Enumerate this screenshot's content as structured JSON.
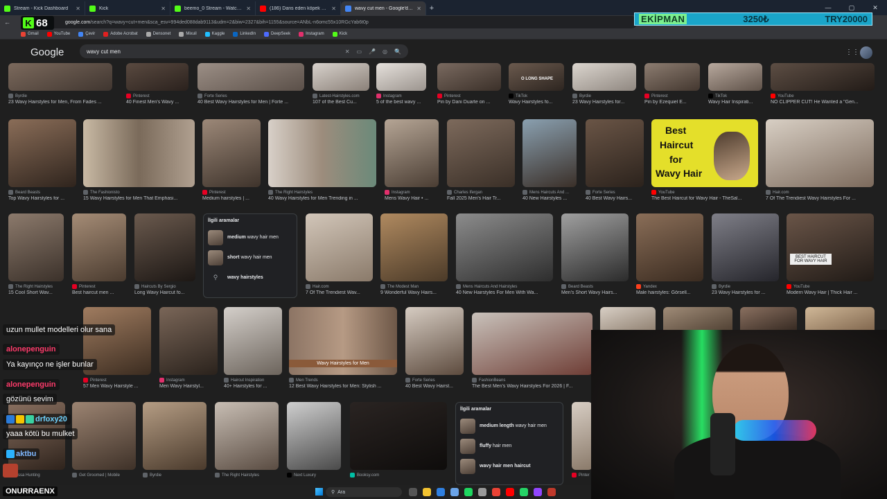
{
  "browser": {
    "tabs": [
      {
        "title": "Stream - Kick Dashboard",
        "color": "#53fc18",
        "active": false
      },
      {
        "title": "Kick",
        "color": "#53fc18",
        "active": false
      },
      {
        "title": "beemo_0 Stream - Watch Live o...",
        "color": "#53fc18",
        "active": false
      },
      {
        "title": "(186) Dans eden köpek vs kız",
        "color": "#ff0000",
        "active": false
      },
      {
        "title": "wavy cut men - Google'da Ara",
        "color": "#4285f4",
        "active": true
      }
    ],
    "new_tab_label": "+",
    "url_host": "google.com",
    "url_rest": "/search?q=wavy+cut+men&sca_esv=994ded088dab9113&udm=2&biw=2327&bih=1155&source=ANbL-n6omc55x10RGcYab6t0p",
    "window_controls": [
      "—",
      "▢",
      "✕"
    ]
  },
  "kick_overlay": {
    "count": "68",
    "logo_letter": "K"
  },
  "goal_bar": {
    "label": "EKİPMAN",
    "current": "3250₺",
    "target": "TRY20000"
  },
  "bookmarks": [
    {
      "label": "Gmail",
      "color": "#ea4335"
    },
    {
      "label": "YouTube",
      "color": "#ff0000"
    },
    {
      "label": "Çevir",
      "color": "#4285f4"
    },
    {
      "label": "Adobe Acrobat",
      "color": "#e02020"
    },
    {
      "label": "Densonet",
      "color": "#aaaaaa"
    },
    {
      "label": "Mixuil",
      "color": "#aaaaaa"
    },
    {
      "label": "Kaggle",
      "color": "#20beff"
    },
    {
      "label": "LinkedIn",
      "color": "#0a66c2"
    },
    {
      "label": "DeepSeek",
      "color": "#4d6bfe"
    },
    {
      "label": "Instagram",
      "color": "#e1306c"
    },
    {
      "label": "Kick",
      "color": "#53fc18"
    }
  ],
  "google": {
    "logo": "Google",
    "query": "wavy cut men",
    "search_icons": [
      "✕",
      "▭",
      "🎤",
      "◎",
      "🔍"
    ],
    "apps_icon": "⋮⋮⋮"
  },
  "row1": [
    {
      "source": "Byrdie",
      "caption": "23 Wavy Hairstyles for Men, From Fades ..."
    },
    {
      "source": "Pinterest",
      "caption": "40 Finest Men's Wavy ..."
    },
    {
      "source": "Forte Series",
      "caption": "40 Best Wavy Hairstyles for Men | Forte ..."
    },
    {
      "source": "Latest-Hairstyles.com",
      "caption": "107 of the Best Cu..."
    },
    {
      "source": "Instagram",
      "caption": "5 of the best wavy ..."
    },
    {
      "source": "Pinterest",
      "caption": "Pin by Dani Duarte on ..."
    },
    {
      "source": "TikTok",
      "caption": "Wavy Hairstyles fo..."
    },
    {
      "source": "Byrdie",
      "caption": "23 Wavy Hairstyles for..."
    },
    {
      "source": "Pinterest",
      "caption": "Pin by Ezequiel E..."
    },
    {
      "source": "TikTok",
      "caption": "Wavy Hair Inspirati..."
    },
    {
      "source": "YouTube",
      "caption": "NO CLIPPER CUT! He Wanted a \"Gen..."
    }
  ],
  "row2": [
    {
      "source": "Beard Beasts",
      "caption": "Top Wavy Hairstyles for ..."
    },
    {
      "source": "The Fashionisto",
      "caption": "15 Wavy Hairstyles for Men That Emphasi..."
    },
    {
      "source": "Pinterest",
      "caption": "Medium hairstyles | ..."
    },
    {
      "source": "The Right Hairstyles",
      "caption": "40 Wavy Hairstyles for Men Trending in ..."
    },
    {
      "source": "Instagram",
      "caption": "Mens Wavy Hair • ..."
    },
    {
      "source": "Charles Ifergan",
      "caption": "Fall 2025 Men's Hair Tr..."
    },
    {
      "source": "Mens Haircuts And ...",
      "caption": "40 New Hairstyles ..."
    },
    {
      "source": "Forte Series",
      "caption": "40 Best Wavy Hairs..."
    },
    {
      "source": "YouTube",
      "caption": "The Best Haircut for Wavy Hair - TheSal..."
    },
    {
      "source": "Hair.com",
      "caption": "7 Of The Trendiest Wavy Hairstyles For ..."
    }
  ],
  "yellow_card": {
    "l1": "Best",
    "l2": "Haircut",
    "l3": "for",
    "l4": "Wavy Hair"
  },
  "row3": [
    {
      "source": "The Right Hairstyles",
      "caption": "15 Cool Short Wav..."
    },
    {
      "source": "Pinterest",
      "caption": "Best haircut men ..."
    },
    {
      "source": "Haircuts By Sergio",
      "caption": "Long Wavy Haircut fo..."
    },
    {
      "source": "Hair.com",
      "caption": "7 Of The Trendiest Wav..."
    },
    {
      "source": "The Modest Man",
      "caption": "9 Wonderful Wavy Hairs..."
    },
    {
      "source": "Mens Haircuts And Hairstyles",
      "caption": "40 New Hairstyles For Men With Wa..."
    },
    {
      "source": "Beard Beasts",
      "caption": "Men's Short Wavy Hairs..."
    },
    {
      "source": "Yandex",
      "caption": "Male hairstyles: Görsell..."
    },
    {
      "source": "Byrdie",
      "caption": "23 Wavy Hairstyles for ..."
    },
    {
      "source": "YouTube",
      "caption": "Modern Wavy Hair | Thick Hair ..."
    }
  ],
  "row4": [
    {
      "source": "Pinterest",
      "caption": "57 Men Wavy Hairstyle ..."
    },
    {
      "source": "Instagram",
      "caption": "Men Wavy Hairstyl..."
    },
    {
      "source": "Haircut Inspiration",
      "caption": "40+ Hairstyles for ..."
    },
    {
      "source": "Men Trends",
      "caption": "12 Best Wavy Hairstyles for Men: Stylish ..."
    },
    {
      "source": "Forte Series",
      "caption": "40 Best Wavy Hairst..."
    },
    {
      "source": "FashionBeans",
      "caption": "The Best Men's Wavy Hairstyles For 2026 | F..."
    }
  ],
  "img_label_wavy": "Wavy Hairstyles for Men",
  "img_label_best": "BEST HAIRCUT FOR WAVY HAIR",
  "img_label_long_shape": "O LONG SHAPE",
  "row5": [
    {
      "source": "Essa Hunting",
      "caption": ""
    },
    {
      "source": "Get Groomed | Mobile",
      "caption": ""
    },
    {
      "source": "Byrdie",
      "caption": ""
    },
    {
      "source": "The Right Hairstyles",
      "caption": ""
    },
    {
      "source": "Next Luxury",
      "caption": ""
    },
    {
      "source": "Booksy.com",
      "caption": ""
    },
    {
      "source": "Pinter",
      "caption": ""
    }
  ],
  "related1": {
    "title": "İlgili aramalar",
    "items": [
      {
        "bold": "medium",
        "rest": " wavy hair men"
      },
      {
        "bold": "short",
        "rest": " wavy hair men"
      },
      {
        "bold": "",
        "rest": "wavy hairstyles"
      }
    ]
  },
  "related2": {
    "title": "İlgili aramalar",
    "items": [
      {
        "bold": "medium length",
        "rest": " wavy hair men"
      },
      {
        "bold": "fluffy",
        "rest": " hair men"
      },
      {
        "bold": "",
        "rest": "wavy hair men haircut"
      }
    ]
  },
  "chat": [
    {
      "user": "",
      "msg": "uzun mullet modelleri olur sana"
    },
    {
      "user": "alonepenguin",
      "msg": ""
    },
    {
      "user": "",
      "msg": "Ya kayınço ne işler bunlar"
    },
    {
      "user": "alonepenguin",
      "msg": ""
    },
    {
      "user": "",
      "msg": "gözünü sevim"
    },
    {
      "user": "drfoxy20",
      "msg": ""
    },
    {
      "user": "",
      "msg": "yaaa kötü bu mulket"
    },
    {
      "user": "aktbu",
      "msg": ""
    }
  ],
  "colors": {
    "alonepenguin": "#ff3b6b",
    "drfoxy20": "#6fd3ff",
    "aktbu": "#7fb8ff"
  },
  "streamer_name": "ONURRAENX",
  "taskbar": {
    "search_placeholder": "Ara"
  }
}
